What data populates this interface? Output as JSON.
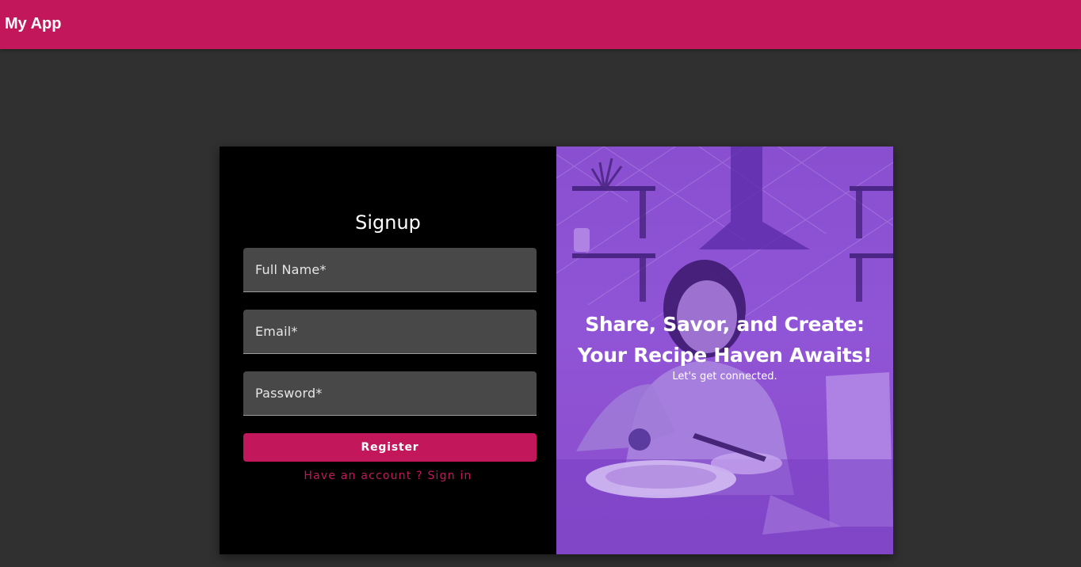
{
  "app": {
    "title": "My App"
  },
  "signup": {
    "title": "Signup",
    "fields": {
      "full_name_placeholder": "Full Name*",
      "email_placeholder": "Email*",
      "password_placeholder": "Password*"
    },
    "register_label": "Register",
    "signin_link": "Have an account ? Sign in"
  },
  "hero": {
    "title": "Share, Savor, and Create: Your Recipe Haven Awaits!",
    "subtitle": "Let's get connected."
  },
  "colors": {
    "primary": "#c2185b",
    "background": "#303030",
    "form_panel": "#000000",
    "field": "#484848",
    "image_overlay": "#9054d6"
  }
}
